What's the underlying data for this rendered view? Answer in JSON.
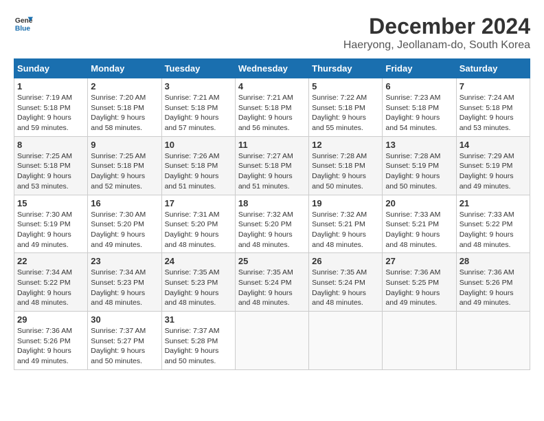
{
  "header": {
    "logo_line1": "General",
    "logo_line2": "Blue",
    "title": "December 2024",
    "subtitle": "Haeryong, Jeollanam-do, South Korea"
  },
  "calendar": {
    "days_of_week": [
      "Sunday",
      "Monday",
      "Tuesday",
      "Wednesday",
      "Thursday",
      "Friday",
      "Saturday"
    ],
    "weeks": [
      [
        {
          "day": "",
          "info": ""
        },
        {
          "day": "2",
          "info": "Sunrise: 7:20 AM\nSunset: 5:18 PM\nDaylight: 9 hours\nand 58 minutes."
        },
        {
          "day": "3",
          "info": "Sunrise: 7:21 AM\nSunset: 5:18 PM\nDaylight: 9 hours\nand 57 minutes."
        },
        {
          "day": "4",
          "info": "Sunrise: 7:21 AM\nSunset: 5:18 PM\nDaylight: 9 hours\nand 56 minutes."
        },
        {
          "day": "5",
          "info": "Sunrise: 7:22 AM\nSunset: 5:18 PM\nDaylight: 9 hours\nand 55 minutes."
        },
        {
          "day": "6",
          "info": "Sunrise: 7:23 AM\nSunset: 5:18 PM\nDaylight: 9 hours\nand 54 minutes."
        },
        {
          "day": "7",
          "info": "Sunrise: 7:24 AM\nSunset: 5:18 PM\nDaylight: 9 hours\nand 53 minutes."
        }
      ],
      [
        {
          "day": "1",
          "info": "Sunrise: 7:19 AM\nSunset: 5:18 PM\nDaylight: 9 hours\nand 59 minutes."
        },
        {
          "day": "9",
          "info": "Sunrise: 7:25 AM\nSunset: 5:18 PM\nDaylight: 9 hours\nand 52 minutes."
        },
        {
          "day": "10",
          "info": "Sunrise: 7:26 AM\nSunset: 5:18 PM\nDaylight: 9 hours\nand 51 minutes."
        },
        {
          "day": "11",
          "info": "Sunrise: 7:27 AM\nSunset: 5:18 PM\nDaylight: 9 hours\nand 51 minutes."
        },
        {
          "day": "12",
          "info": "Sunrise: 7:28 AM\nSunset: 5:18 PM\nDaylight: 9 hours\nand 50 minutes."
        },
        {
          "day": "13",
          "info": "Sunrise: 7:28 AM\nSunset: 5:19 PM\nDaylight: 9 hours\nand 50 minutes."
        },
        {
          "day": "14",
          "info": "Sunrise: 7:29 AM\nSunset: 5:19 PM\nDaylight: 9 hours\nand 49 minutes."
        }
      ],
      [
        {
          "day": "8",
          "info": "Sunrise: 7:25 AM\nSunset: 5:18 PM\nDaylight: 9 hours\nand 53 minutes."
        },
        {
          "day": "16",
          "info": "Sunrise: 7:30 AM\nSunset: 5:20 PM\nDaylight: 9 hours\nand 49 minutes."
        },
        {
          "day": "17",
          "info": "Sunrise: 7:31 AM\nSunset: 5:20 PM\nDaylight: 9 hours\nand 48 minutes."
        },
        {
          "day": "18",
          "info": "Sunrise: 7:32 AM\nSunset: 5:20 PM\nDaylight: 9 hours\nand 48 minutes."
        },
        {
          "day": "19",
          "info": "Sunrise: 7:32 AM\nSunset: 5:21 PM\nDaylight: 9 hours\nand 48 minutes."
        },
        {
          "day": "20",
          "info": "Sunrise: 7:33 AM\nSunset: 5:21 PM\nDaylight: 9 hours\nand 48 minutes."
        },
        {
          "day": "21",
          "info": "Sunrise: 7:33 AM\nSunset: 5:22 PM\nDaylight: 9 hours\nand 48 minutes."
        }
      ],
      [
        {
          "day": "15",
          "info": "Sunrise: 7:30 AM\nSunset: 5:19 PM\nDaylight: 9 hours\nand 49 minutes."
        },
        {
          "day": "23",
          "info": "Sunrise: 7:34 AM\nSunset: 5:23 PM\nDaylight: 9 hours\nand 48 minutes."
        },
        {
          "day": "24",
          "info": "Sunrise: 7:35 AM\nSunset: 5:23 PM\nDaylight: 9 hours\nand 48 minutes."
        },
        {
          "day": "25",
          "info": "Sunrise: 7:35 AM\nSunset: 5:24 PM\nDaylight: 9 hours\nand 48 minutes."
        },
        {
          "day": "26",
          "info": "Sunrise: 7:35 AM\nSunset: 5:24 PM\nDaylight: 9 hours\nand 48 minutes."
        },
        {
          "day": "27",
          "info": "Sunrise: 7:36 AM\nSunset: 5:25 PM\nDaylight: 9 hours\nand 49 minutes."
        },
        {
          "day": "28",
          "info": "Sunrise: 7:36 AM\nSunset: 5:26 PM\nDaylight: 9 hours\nand 49 minutes."
        }
      ],
      [
        {
          "day": "22",
          "info": "Sunrise: 7:34 AM\nSunset: 5:22 PM\nDaylight: 9 hours\nand 48 minutes."
        },
        {
          "day": "30",
          "info": "Sunrise: 7:37 AM\nSunset: 5:27 PM\nDaylight: 9 hours\nand 50 minutes."
        },
        {
          "day": "31",
          "info": "Sunrise: 7:37 AM\nSunset: 5:28 PM\nDaylight: 9 hours\nand 50 minutes."
        },
        {
          "day": "",
          "info": ""
        },
        {
          "day": "",
          "info": ""
        },
        {
          "day": "",
          "info": ""
        },
        {
          "day": "",
          "info": ""
        }
      ],
      [
        {
          "day": "29",
          "info": "Sunrise: 7:36 AM\nSunset: 5:26 PM\nDaylight: 9 hours\nand 49 minutes."
        },
        {
          "day": "",
          "info": ""
        },
        {
          "day": "",
          "info": ""
        },
        {
          "day": "",
          "info": ""
        },
        {
          "day": "",
          "info": ""
        },
        {
          "day": "",
          "info": ""
        },
        {
          "day": "",
          "info": ""
        }
      ]
    ]
  }
}
